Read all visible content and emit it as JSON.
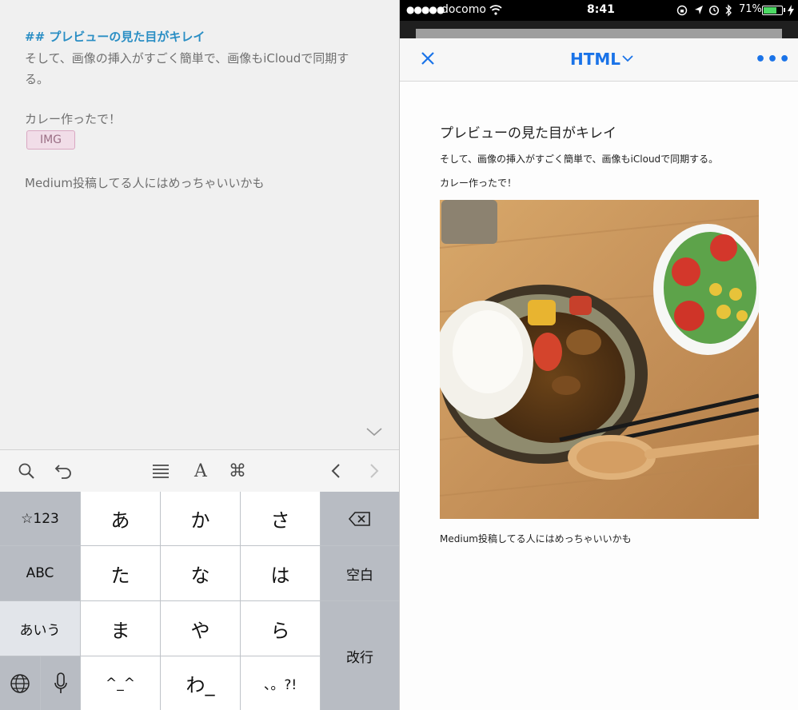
{
  "editor": {
    "heading": "## プレビューの見た目がキレイ",
    "para_line1": "そして、画像の挿入がすごく簡単で、画像もiCloudで同期す",
    "para_line2": "る。",
    "curry": "カレー作ったで！",
    "img_tag": "IMG",
    "medium": "Medium投稿してる人にはめっちゃいいかも"
  },
  "toolbar": {
    "icons": [
      "search-icon",
      "undo-icon",
      "list-icon",
      "font-icon",
      "command-icon",
      "chevron-left-icon",
      "chevron-right-icon"
    ],
    "command_glyph": "⌘",
    "font_glyph": "A"
  },
  "keyboard": {
    "row1": [
      "☆123",
      "あ",
      "か",
      "さ"
    ],
    "row2": [
      "ABC",
      "た",
      "な",
      "は",
      "空白"
    ],
    "row3": [
      "あいう",
      "ま",
      "や",
      "ら",
      "改行"
    ],
    "row4": [
      "^_^",
      "わ_",
      "、。?!"
    ]
  },
  "status_bar": {
    "signal": "●●●●●",
    "carrier": "docomo",
    "time": "8:41",
    "battery_percent": "71%",
    "battery_level": 0.71
  },
  "navbar": {
    "title": "HTML",
    "more": "•••"
  },
  "preview": {
    "heading": "プレビューの見た目がキレイ",
    "para": "そして、画像の挿入がすごく簡単で、画像もiCloudで同期する。",
    "curry": "カレー作ったで！",
    "medium": "Medium投稿してる人にはめっちゃいいかも"
  },
  "colors": {
    "accent": "#1a73e8",
    "heading_markdown": "#2a8ec4"
  }
}
